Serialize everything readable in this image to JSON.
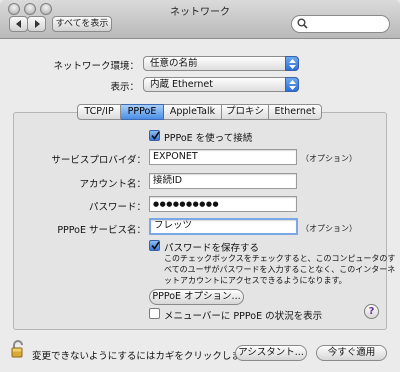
{
  "window": {
    "title": "ネットワーク",
    "show_all_label": "すべてを表示"
  },
  "location": {
    "label": "ネットワーク環境：",
    "value": "任意の名前"
  },
  "show": {
    "label": "表示：",
    "value": "内蔵 Ethernet"
  },
  "tabs": [
    {
      "label": "TCP/IP",
      "active": false
    },
    {
      "label": "PPPoE",
      "active": true
    },
    {
      "label": "AppleTalk",
      "active": false
    },
    {
      "label": "プロキシ",
      "active": false
    },
    {
      "label": "Ethernet",
      "active": false
    }
  ],
  "pppoe": {
    "connect_checkbox": {
      "label": "PPPoE を使って接続",
      "checked": true
    },
    "provider": {
      "label": "サービスプロバイダ：",
      "value": "EXPONET",
      "note": "（オプション）"
    },
    "account": {
      "label": "アカウント名：",
      "value": "接続ID"
    },
    "password": {
      "label": "パスワード：",
      "value": "●●●●●●●●●●"
    },
    "service": {
      "label": "PPPoE サービス名：",
      "value": "フレッツ",
      "note": "（オプション）"
    },
    "save_password": {
      "label": "パスワードを保存する",
      "checked": true,
      "description": "このチェックボックスをチェックすると、このコンピュータのすべてのユーザがパスワードを入力することなく、このインターネットアカウントにアクセスできるようになります。"
    },
    "options_button": "PPPoE オプション...",
    "menubar_checkbox": {
      "label": "メニューバーに PPPoE の状況を表示",
      "checked": false
    },
    "help": "?"
  },
  "footer": {
    "lock_text": "変更できないようにするにはカギをクリックします。",
    "assistant_button": "アシスタント...",
    "apply_button": "今すぐ適用"
  },
  "colors": {
    "accent": "#3a78da",
    "background": "#ebebeb"
  }
}
